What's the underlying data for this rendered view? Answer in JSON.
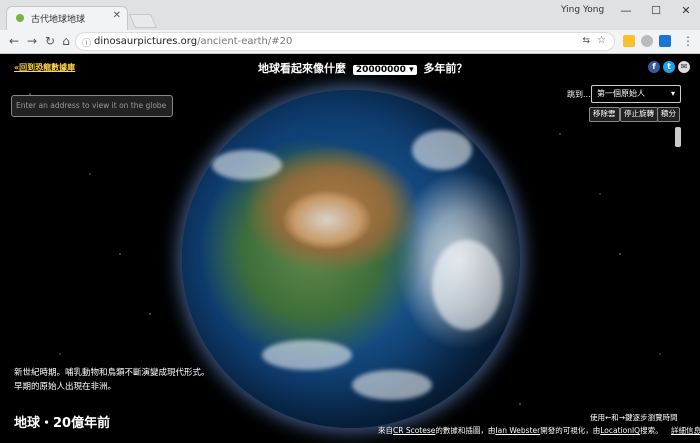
{
  "browser": {
    "tab_title": "古代地球地球",
    "user": "Ying Yong",
    "url_host": "dinosaurpictures.org",
    "url_path": "/ancient-earth/#20",
    "win_min": "—",
    "win_max": "☐",
    "win_close": "✕",
    "tab_close": "✕"
  },
  "page": {
    "logo_link": "«回到恐龍數據庫",
    "title_prefix": "地球看起來像什麼",
    "title_select": "20000000 ▾",
    "title_suffix": "多年前？",
    "address_placeholder": "Enter an address to view it on the globe",
    "jump_label": "跳到...",
    "jump_value": "第一個原始人",
    "jump_caret": "▾",
    "buttons": [
      "移除雲",
      "停止旋轉",
      "積分"
    ],
    "description": "新世紀時期。哺乳動物和鳥類不斷演變成現代形式。早期的原始人出現在非洲。",
    "era_title": "地球・20億年前",
    "hint": "使用←和→鍵逐步瀏覽時間",
    "credits": {
      "prefix": "來自",
      "source1": "CR Scotese",
      "mid1": "的數據和插圖，由",
      "source2": "Ian Webster",
      "mid2": "開發的可視化，由",
      "source3": "LocationIQ",
      "suffix": "搜索。",
      "details": "詳細信息 »"
    },
    "social": [
      "f",
      "t",
      "✉"
    ]
  },
  "colors": {
    "logo_link": "#ffd24d",
    "facebook": "#3b5998",
    "twitter": "#1da1f2",
    "mail": "#dddddd"
  }
}
